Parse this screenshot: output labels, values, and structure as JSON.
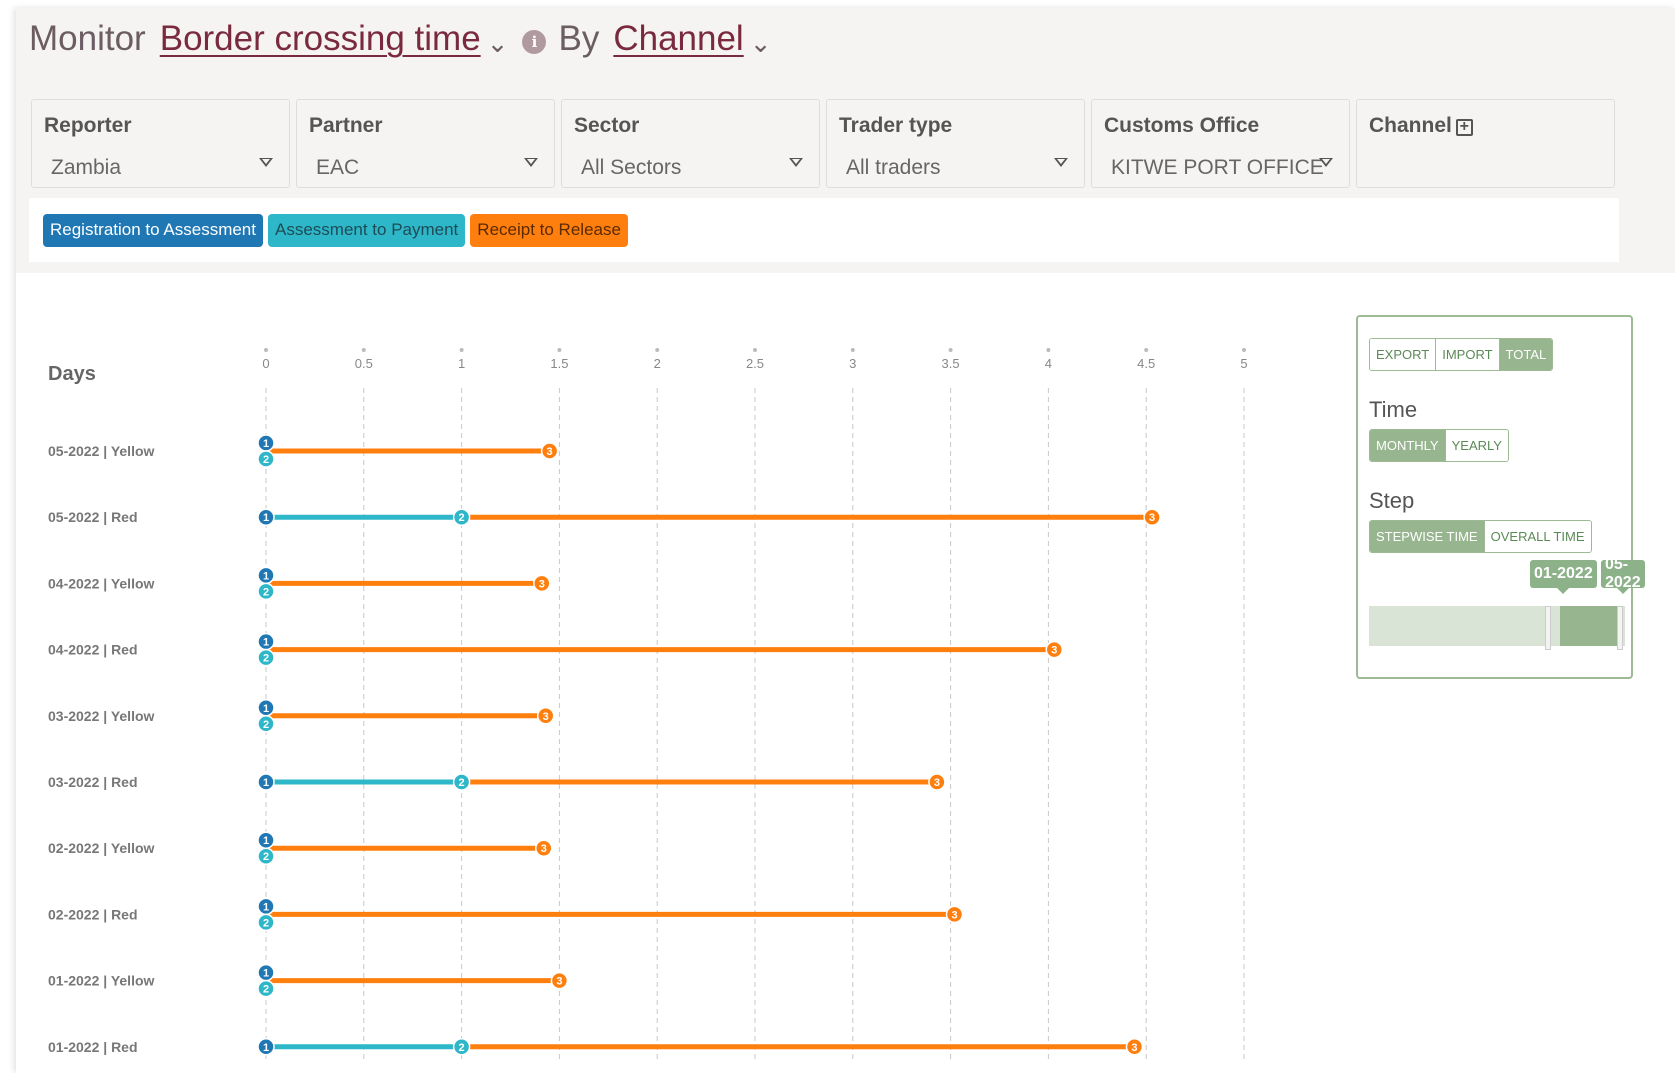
{
  "header": {
    "monitor_label": "Monitor",
    "indicator": "Border crossing time",
    "by_label": "By",
    "dimension": "Channel"
  },
  "filters": [
    {
      "label": "Reporter",
      "value": "Zambia",
      "has_dropdown": true
    },
    {
      "label": "Partner",
      "value": "EAC",
      "has_dropdown": true
    },
    {
      "label": "Sector",
      "value": "All Sectors",
      "has_dropdown": true
    },
    {
      "label": "Trader type",
      "value": "All traders",
      "has_dropdown": true
    },
    {
      "label": "Customs Office",
      "value": "KITWE PORT OFFICE",
      "has_dropdown": true
    },
    {
      "label": "Channel",
      "value": "",
      "has_dropdown": false
    }
  ],
  "legend": [
    {
      "label": "Registration to Assessment",
      "color": "#1f77b4"
    },
    {
      "label": "Assessment to Payment",
      "color": "#2db7c8"
    },
    {
      "label": "Receipt to Release",
      "color": "#ff7f0e"
    }
  ],
  "controls": {
    "flow_buttons": [
      "EXPORT",
      "IMPORT",
      "TOTAL"
    ],
    "flow_active": "TOTAL",
    "time_heading": "Time",
    "time_buttons": [
      "MONTHLY",
      "YEARLY"
    ],
    "time_active": "MONTHLY",
    "step_heading": "Step",
    "step_buttons": [
      "STEPWISE TIME",
      "OVERALL TIME"
    ],
    "step_active": "STEPWISE TIME",
    "range_start": "01-2022",
    "range_end": "05-2022"
  },
  "chart_data": {
    "type": "line",
    "orientation": "horizontal-dumbbell",
    "ylabel": "Days",
    "xlim": [
      0,
      5
    ],
    "x_ticks": [
      "0",
      "0.5",
      "1",
      "1.5",
      "2",
      "2.5",
      "3",
      "3.5",
      "4",
      "4.5",
      "5"
    ],
    "grid": true,
    "series": [
      {
        "name": "Registration to Assessment",
        "marker": "1",
        "color": "#1f77b4"
      },
      {
        "name": "Assessment to Payment",
        "marker": "2",
        "color": "#2db7c8"
      },
      {
        "name": "Receipt to Release",
        "marker": "3",
        "color": "#ff7f0e"
      }
    ],
    "rows": [
      {
        "label": "05-2022 | Yellow",
        "p1": 0,
        "p2": 0,
        "p3": 1.45
      },
      {
        "label": "05-2022 | Red",
        "p1": 0,
        "p2": 1.0,
        "p3": 4.53
      },
      {
        "label": "04-2022 | Yellow",
        "p1": 0,
        "p2": 0,
        "p3": 1.41
      },
      {
        "label": "04-2022 | Red",
        "p1": 0,
        "p2": 0,
        "p3": 4.03
      },
      {
        "label": "03-2022 | Yellow",
        "p1": 0,
        "p2": 0,
        "p3": 1.43
      },
      {
        "label": "03-2022 | Red",
        "p1": 0,
        "p2": 1.0,
        "p3": 3.43
      },
      {
        "label": "02-2022 | Yellow",
        "p1": 0,
        "p2": 0,
        "p3": 1.42
      },
      {
        "label": "02-2022 | Red",
        "p1": 0,
        "p2": 0,
        "p3": 3.52
      },
      {
        "label": "01-2022 | Yellow",
        "p1": 0,
        "p2": 0,
        "p3": 1.5
      },
      {
        "label": "01-2022 | Red",
        "p1": 0,
        "p2": 1.0,
        "p3": 4.44
      }
    ]
  }
}
